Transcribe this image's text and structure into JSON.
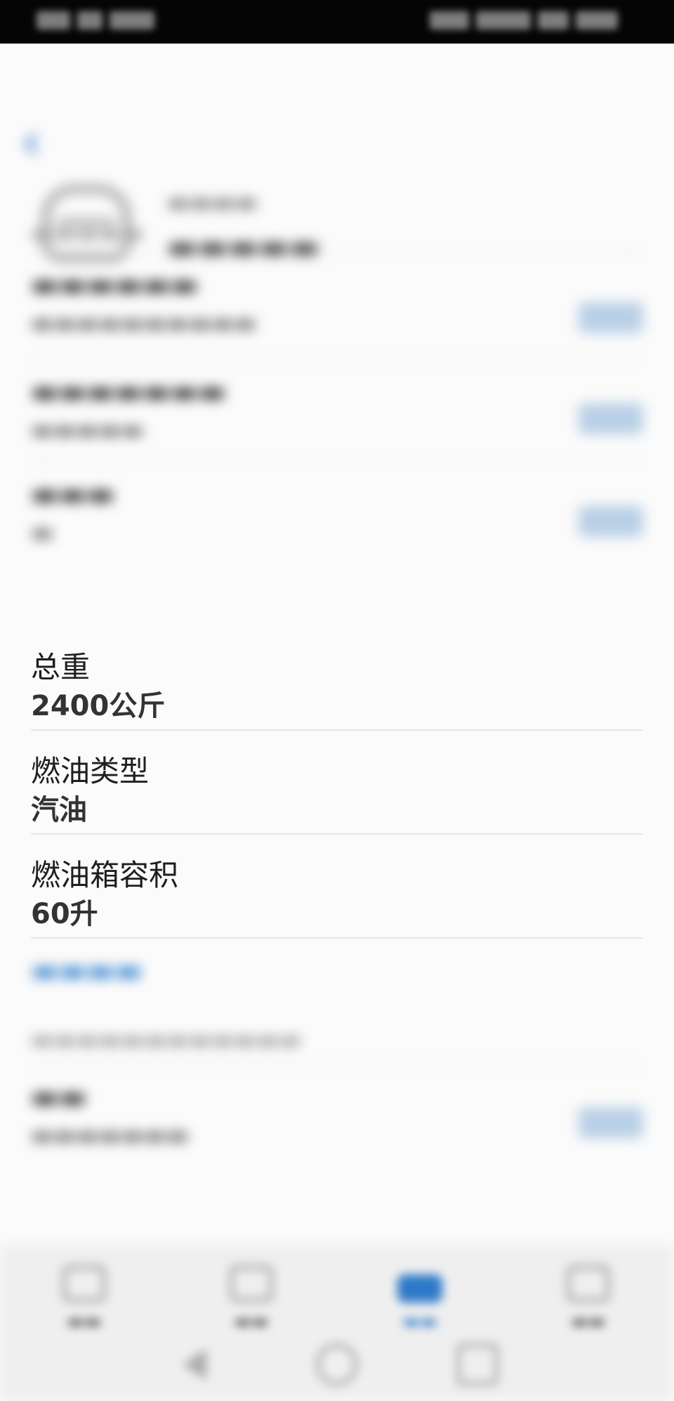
{
  "vehicle_details": {
    "gross_weight": {
      "label": "总重",
      "value": "2400公斤"
    },
    "fuel_type": {
      "label": "燃油类型",
      "value": "汽油"
    },
    "fuel_tank_capacity": {
      "label": "燃油箱容积",
      "value": "60升"
    }
  },
  "colors": {
    "accent": "#2d79c7",
    "status_bar": "#050505",
    "divider": "#e5e5e5"
  },
  "icons": {
    "back": "chevron-left-icon",
    "car": "car-icon",
    "nav_active": "vehicle-icon"
  }
}
